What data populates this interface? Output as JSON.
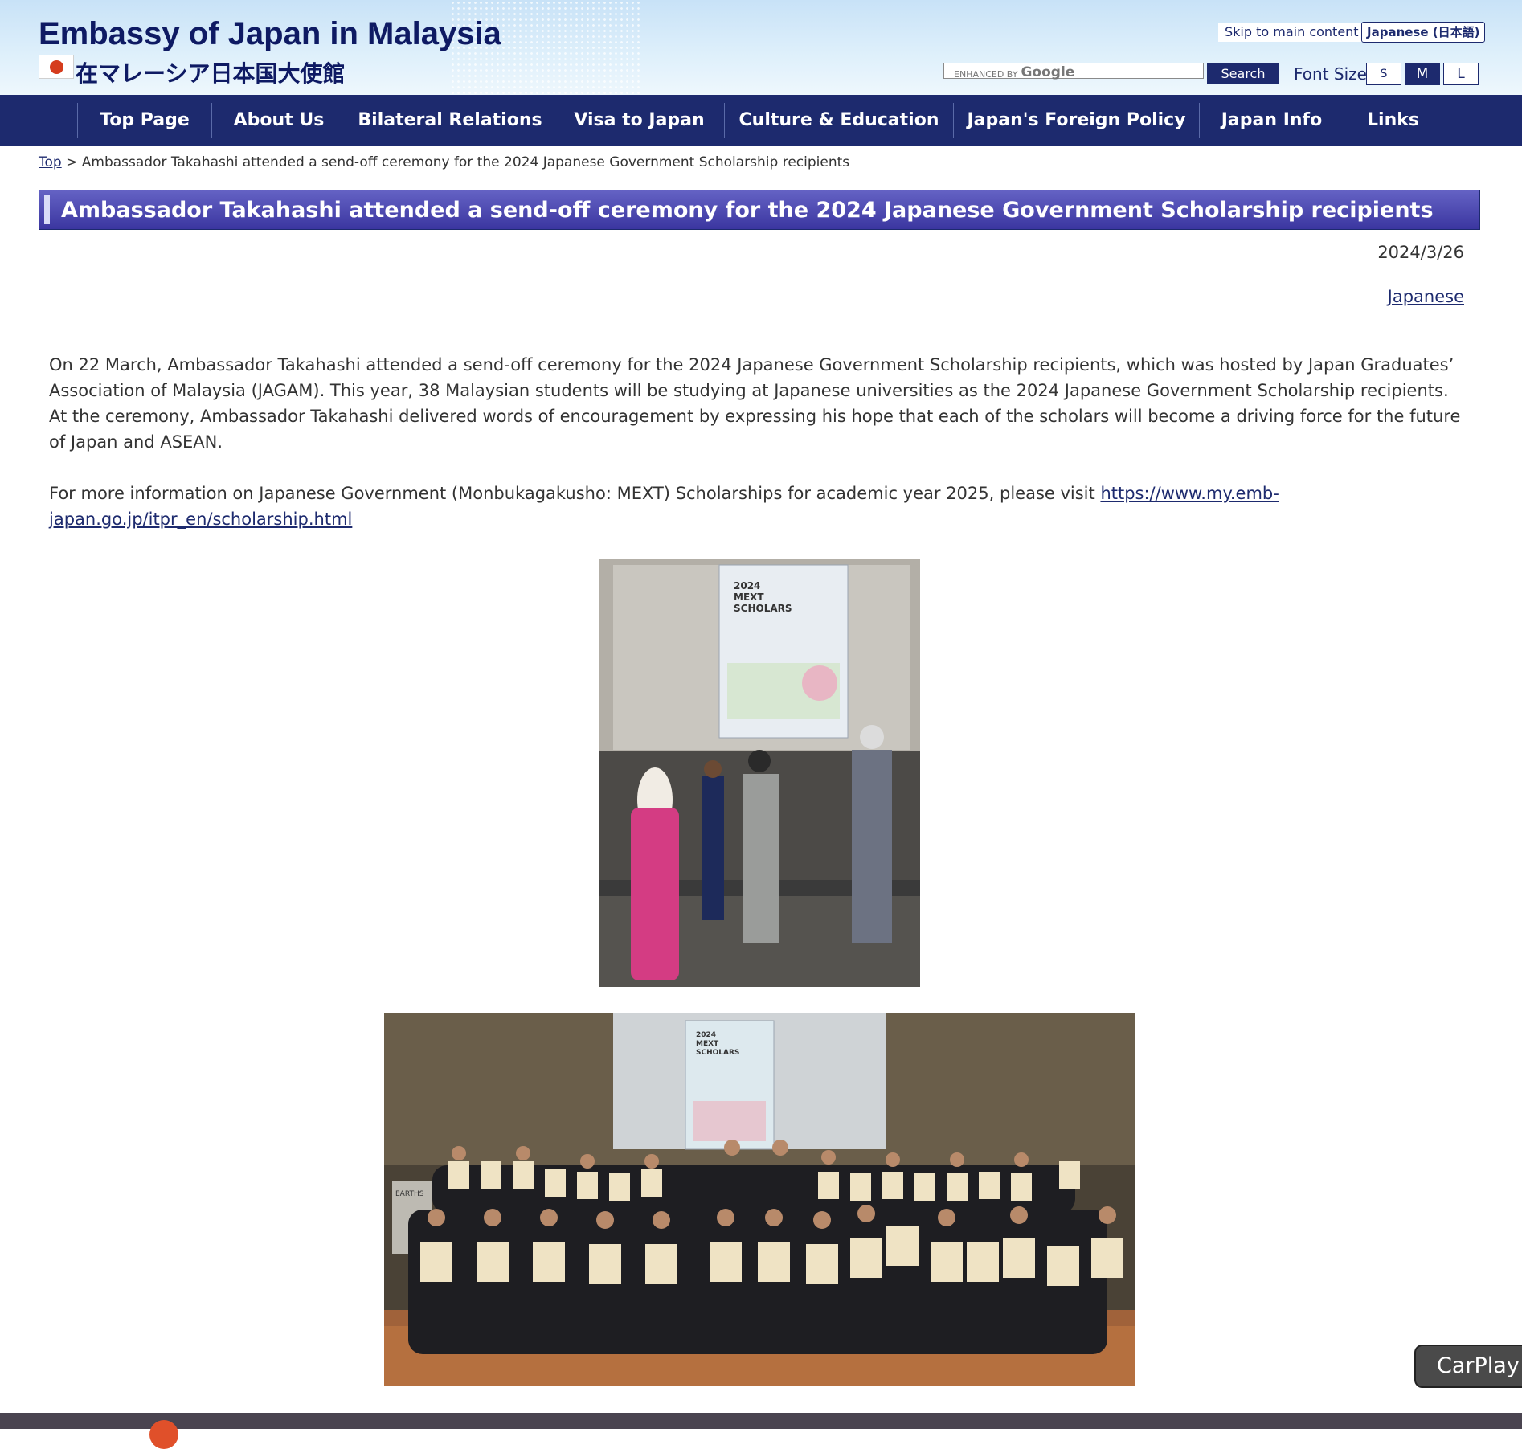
{
  "header": {
    "site_title": "Embassy of Japan in Malaysia",
    "site_subtitle": "在マレーシア日本国大使館",
    "skip_link": "Skip to main content",
    "lang_switch": "Japanese (日本語)",
    "search": {
      "enhanced_by": "ENHANCED BY",
      "google": "Google",
      "button": "Search"
    },
    "font_size": {
      "label": "Font Size",
      "options": [
        "S",
        "M",
        "L"
      ],
      "selected": "M"
    }
  },
  "nav": {
    "items": [
      "Top Page",
      "About Us",
      "Bilateral Relations",
      "Visa to Japan",
      "Culture & Education",
      "Japan's Foreign Policy",
      "Japan Info",
      "Links"
    ]
  },
  "breadcrumb": {
    "home": "Top",
    "separator": ">",
    "current": "Ambassador Takahashi attended a send-off ceremony for the 2024 Japanese Government Scholarship recipients"
  },
  "article": {
    "title": "Ambassador Takahashi attended a send-off ceremony for the 2024 Japanese Government Scholarship recipients",
    "date": "2024/3/26",
    "japanese_link": "Japanese",
    "paragraph1": "On 22 March, Ambassador Takahashi attended a send-off ceremony for the 2024 Japanese Government Scholarship recipients, which was hosted by Japan Graduates’ Association of Malaysia (JAGAM). This year, 38 Malaysian students will be studying at Japanese universities as the 2024 Japanese Government Scholarship recipients. At the ceremony, Ambassador Takahashi delivered words of encouragement by expressing his hope that each of the scholars will become a driving force for the future of Japan and ASEAN.",
    "paragraph2_text": "For more information on Japanese Government (Monbukagakusho: MEXT) Scholarships for academic year 2025, please visit ",
    "paragraph2_link": "https://www.my.emb-japan.go.jp/itpr_en/scholarship.html",
    "poster_text": [
      "2024",
      "MEXT",
      "SCHOLARS"
    ],
    "lectern_text": "EARTHS"
  },
  "overlay": {
    "carplay": "CarPlay"
  },
  "colors": {
    "navy": "#1d2a6e",
    "title_bar": "#4a46b0",
    "flag_red": "#d53c1d"
  }
}
